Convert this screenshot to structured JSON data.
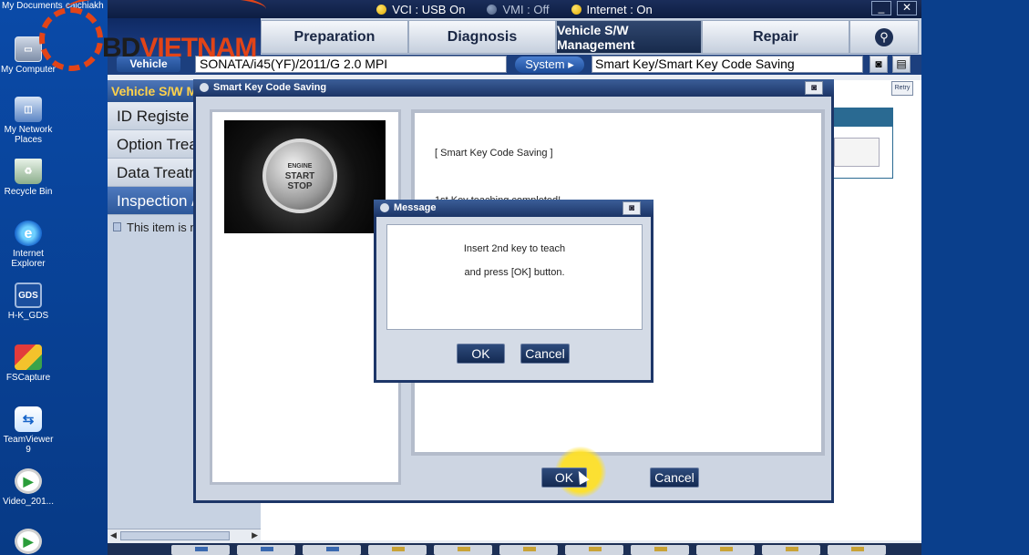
{
  "desktop": {
    "top_labels": [
      "My Documents",
      "caichiakh"
    ],
    "icons": [
      {
        "label": "My Computer",
        "icon": "computer-icon"
      },
      {
        "label": "My Network Places",
        "icon": "network-icon"
      },
      {
        "label": "Recycle Bin",
        "icon": "recycle-bin-icon"
      },
      {
        "label": "Internet Explorer",
        "icon": "internet-explorer-icon"
      },
      {
        "label": "H-K_GDS",
        "icon": "gds-icon"
      },
      {
        "label": "FSCapture",
        "icon": "fscapture-icon"
      },
      {
        "label": "TeamViewer 9",
        "icon": "teamviewer-icon"
      },
      {
        "label": "Video_201...",
        "icon": "video-file-icon"
      }
    ],
    "gds_icon_text": "GDS"
  },
  "status": {
    "vci": "VCI : USB On",
    "vmi": "VMI : Off",
    "internet": "Internet : On"
  },
  "window_controls": {
    "minimize": "_",
    "close": "✕"
  },
  "menu": {
    "tabs": [
      "Preparation",
      "Diagnosis",
      "Vehicle S/W Management",
      "Repair"
    ],
    "active": "Vehicle S/W Management"
  },
  "infobar": {
    "vehicle_label": "Vehicle",
    "vehicle_value": "SONATA/i45(YF)/2011/G 2.0 MPI",
    "system_button": "System ▸",
    "path_value": "Smart Key/Smart Key Code Saving"
  },
  "left_panel": {
    "title": "Vehicle S/W M",
    "items": [
      "ID Registe",
      "Option Treatr",
      "Data Treatm",
      "Inspection /"
    ],
    "selected_index": 3,
    "note": "This item is n"
  },
  "retry_label": "Retry",
  "smart_key_dialog": {
    "title": "Smart Key Code Saving",
    "photo_text": [
      "ENGINE",
      "START",
      "STOP"
    ],
    "lines": [
      "[ Smart Key Code Saving ]",
      "1st Key teaching completed!"
    ],
    "ok_label": "OK",
    "cancel_label": "Cancel"
  },
  "message_dialog": {
    "title": "Message",
    "lines": [
      "Insert 2nd key to teach",
      "and press [OK] button."
    ],
    "ok_label": "OK",
    "cancel_label": "Cancel"
  },
  "watermark": {
    "part1": "BD",
    "part2": "VIETNAM"
  },
  "colors": {
    "accent": "#1d3668",
    "highlight": "#ffe128",
    "watermark": "#e24418"
  }
}
